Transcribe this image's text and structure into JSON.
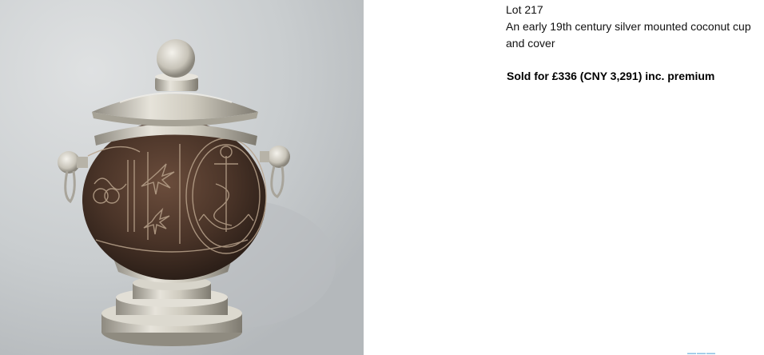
{
  "lot": {
    "number_label": "Lot 217",
    "description": "An early 19th century silver mounted coconut cup and cover",
    "sold_label": "Sold for £336 (CNY 3,291) inc. premium"
  },
  "photo": {
    "subject": "silver mounted coconut cup and cover",
    "background_color": "#c8ccce",
    "silver_color": "#d6d3c8",
    "coconut_color": "#4a352a"
  },
  "links": {
    "bottom_link_color": "#1a86c8"
  }
}
